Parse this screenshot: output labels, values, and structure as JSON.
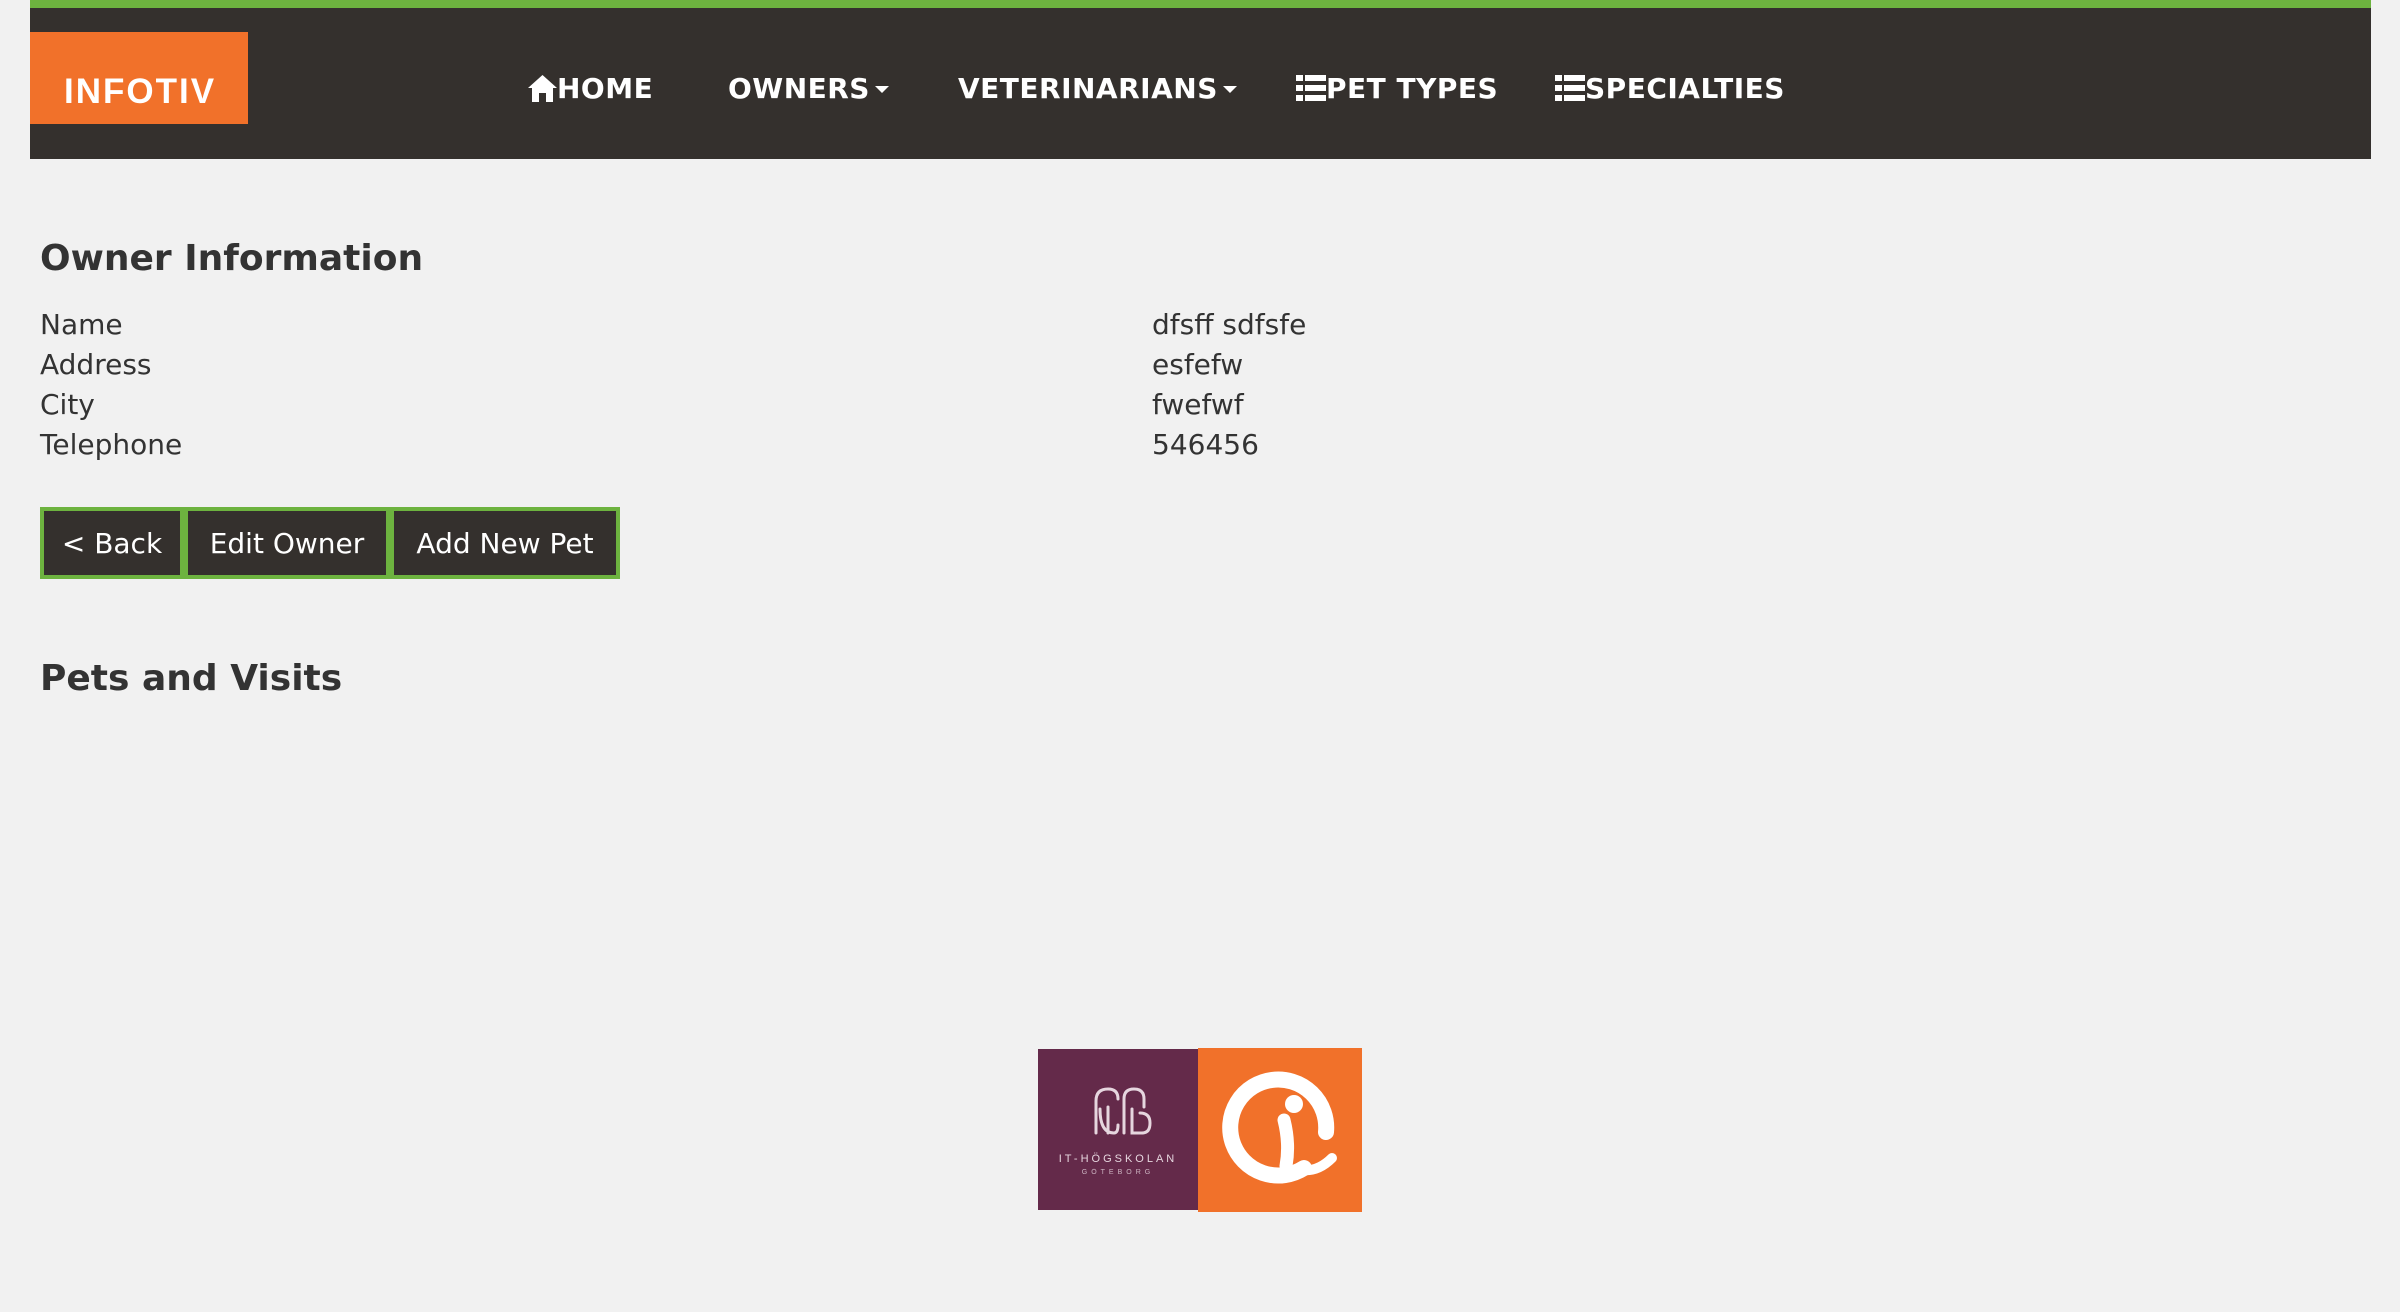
{
  "nav": {
    "brand": "INFOTIV",
    "items": [
      {
        "label": "HOME",
        "icon": "home-icon"
      },
      {
        "label": "OWNERS",
        "icon": "caret-down-icon"
      },
      {
        "label": "VETERINARIANS",
        "icon": "caret-down-icon"
      },
      {
        "label": "PET TYPES",
        "icon": "list-icon"
      },
      {
        "label": "SPECIALTIES",
        "icon": "list-icon"
      }
    ]
  },
  "owner": {
    "title": "Owner Information",
    "fields": [
      {
        "label": "Name",
        "value": "dfsff sdfsfe"
      },
      {
        "label": "Address",
        "value": "esfefw"
      },
      {
        "label": "City",
        "value": "fwefwf"
      },
      {
        "label": "Telephone",
        "value": "546456"
      }
    ]
  },
  "buttons": {
    "back": "< Back",
    "edit": "Edit Owner",
    "add_pet": "Add New Pet"
  },
  "pets": {
    "title": "Pets and Visits"
  },
  "footer": {
    "ith_logo_text": "IT-HÖGSKOLAN",
    "ith_logo_subtext": "GÖTEBORG"
  },
  "colors": {
    "navbar": "#34302d",
    "accent_green": "#6db33f",
    "brand_orange": "#f1712a",
    "ith_purple": "#642a4a",
    "background": "#f1f1f1"
  }
}
